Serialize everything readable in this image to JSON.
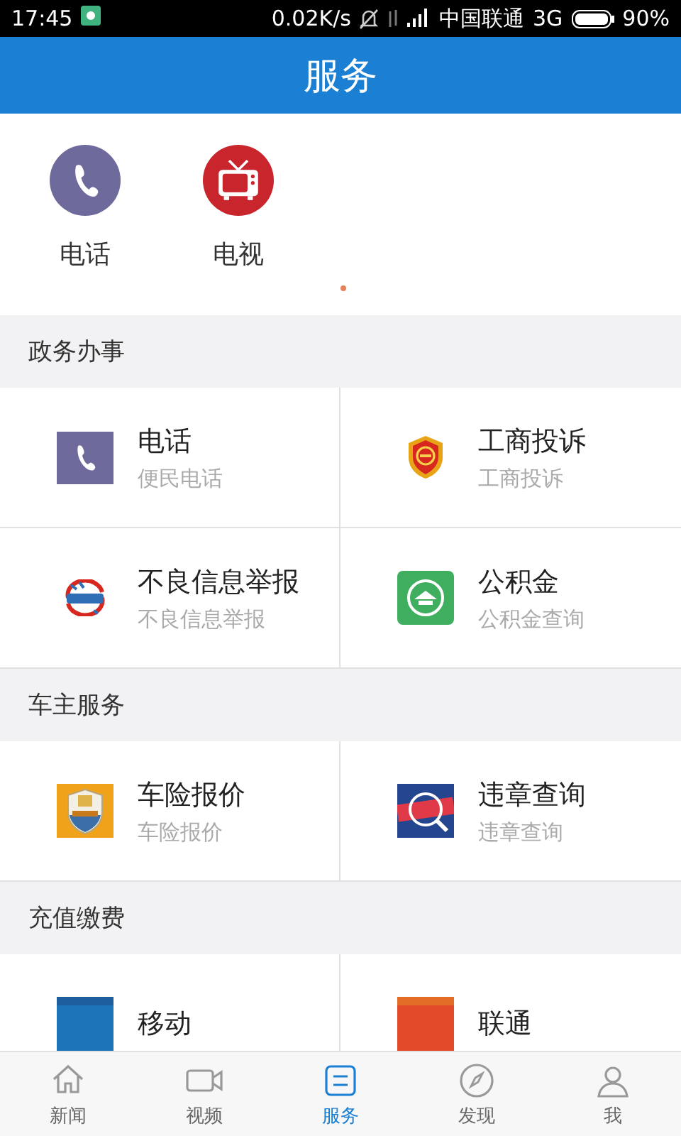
{
  "status_bar": {
    "time": "17:45",
    "speed": "0.02K/s",
    "carrier": "中国联通",
    "network": "3G",
    "battery": "90%"
  },
  "header": {
    "title": "服务"
  },
  "quick_items": [
    {
      "label": "电话",
      "kind": "phone"
    },
    {
      "label": "电视",
      "kind": "tv"
    }
  ],
  "sections": [
    {
      "title": "政务办事",
      "items": [
        {
          "title": "电话",
          "subtitle": "便民电话",
          "kind": "phone"
        },
        {
          "title": "工商投诉",
          "subtitle": "工商投诉",
          "kind": "badge"
        },
        {
          "title": "不良信息举报",
          "subtitle": "不良信息举报",
          "kind": "report"
        },
        {
          "title": "公积金",
          "subtitle": "公积金查询",
          "kind": "fund"
        }
      ]
    },
    {
      "title": "车主服务",
      "items": [
        {
          "title": "车险报价",
          "subtitle": "车险报价",
          "kind": "insurance"
        },
        {
          "title": "违章查询",
          "subtitle": "违章查询",
          "kind": "violation"
        }
      ]
    },
    {
      "title": "充值缴费",
      "items": [
        {
          "title": "移动",
          "kind": "mobile"
        },
        {
          "title": "联通",
          "kind": "unicom"
        }
      ]
    }
  ],
  "nav": [
    {
      "label": "新闻",
      "kind": "home",
      "selected": false
    },
    {
      "label": "视频",
      "kind": "video",
      "selected": false
    },
    {
      "label": "服务",
      "kind": "service",
      "selected": true
    },
    {
      "label": "发现",
      "kind": "discover",
      "selected": false
    },
    {
      "label": "我",
      "kind": "me",
      "selected": false
    }
  ]
}
